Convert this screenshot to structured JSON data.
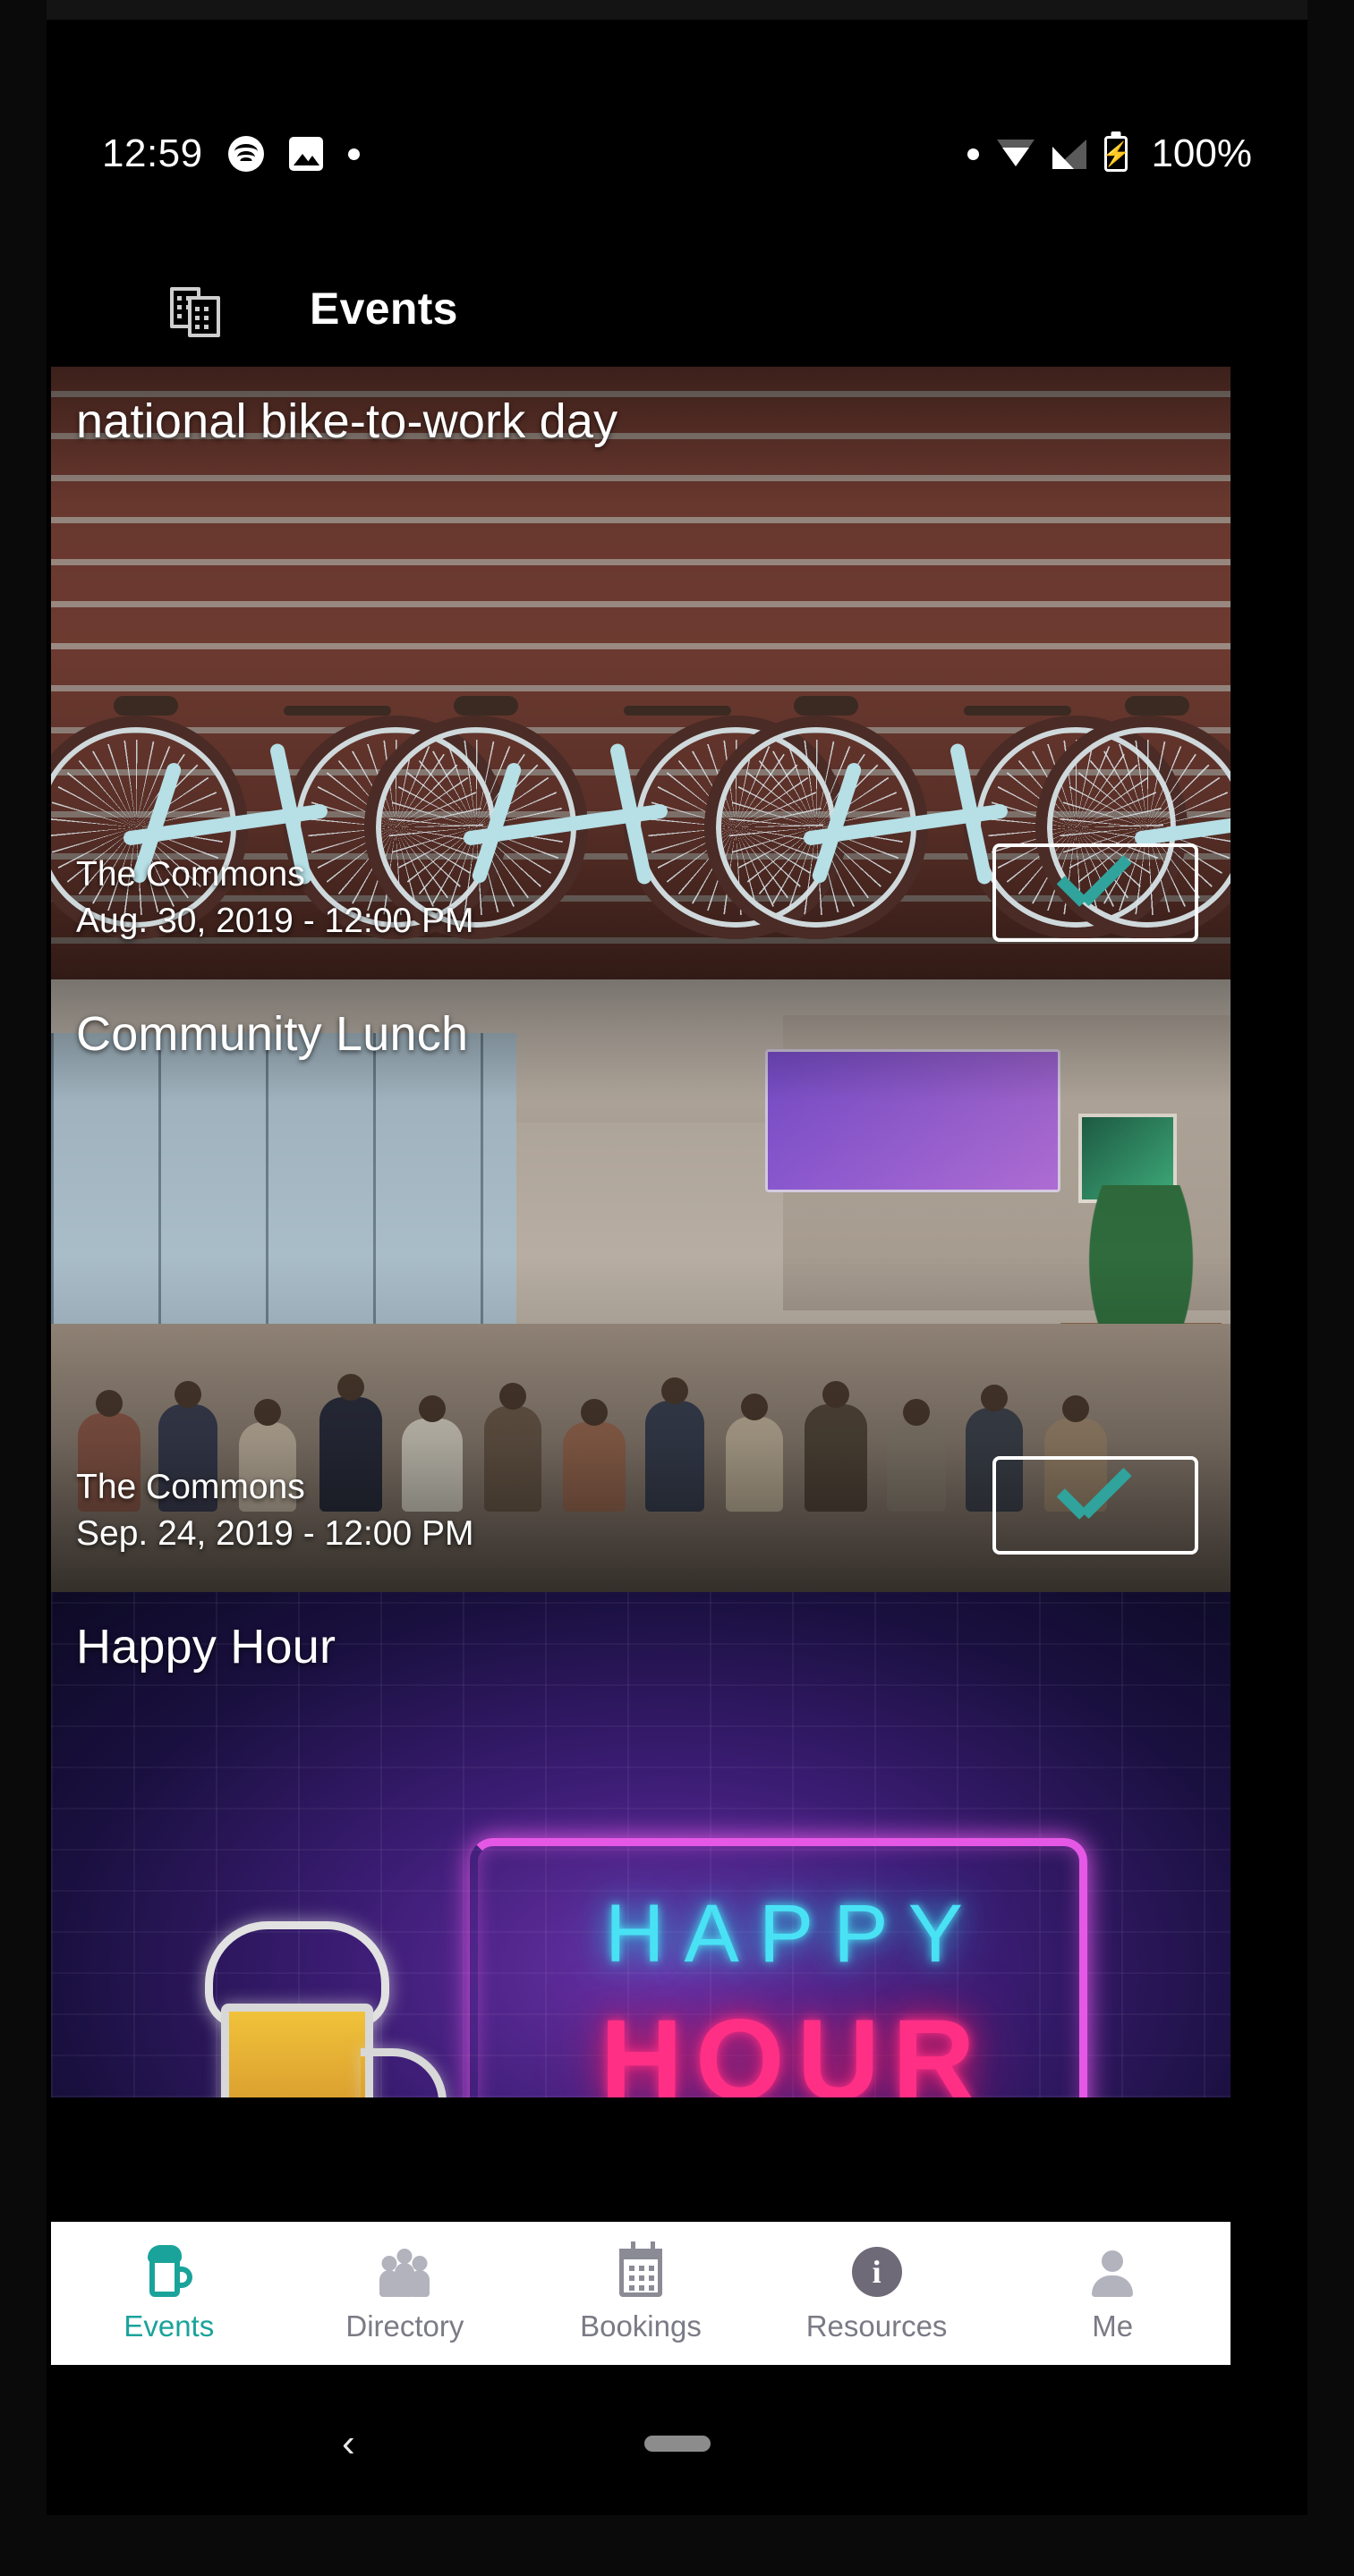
{
  "statusbar": {
    "clock": "12:59",
    "battery_text": "100%",
    "icons_left": [
      "spotify-icon",
      "image-icon",
      "dot-icon"
    ],
    "icons_right": [
      "dot-icon",
      "wifi-icon",
      "cell-signal-icon",
      "battery-charging-icon"
    ]
  },
  "appbar": {
    "icon": "buildings-icon",
    "title": "Events"
  },
  "events": [
    {
      "title": "national bike-to-work day",
      "location": "The Commons",
      "datetime": "Aug. 30, 2019 - 12:00 PM",
      "attend_icon": "check-icon",
      "image": "bicycles-against-brick-wall"
    },
    {
      "title": "Community Lunch",
      "location": "The Commons",
      "datetime": "Sep. 24, 2019 - 12:00 PM",
      "attend_icon": "check-icon",
      "image": "community-room-audience"
    },
    {
      "title": "Happy Hour",
      "image": "happy-hour-neon-sign",
      "neon_line1": "HAPPY",
      "neon_line2": "HOUR"
    }
  ],
  "bottom_nav": {
    "items": [
      {
        "label": "Events",
        "icon": "beer-mug-icon",
        "active": true
      },
      {
        "label": "Directory",
        "icon": "people-icon",
        "active": false
      },
      {
        "label": "Bookings",
        "icon": "calendar-icon",
        "active": false
      },
      {
        "label": "Resources",
        "icon": "info-icon",
        "active": false
      },
      {
        "label": "Me",
        "icon": "person-icon",
        "active": false
      }
    ]
  },
  "system_nav": {
    "back": "‹",
    "home_pill": "home-pill"
  },
  "colors": {
    "accent_teal": "#1aa39b",
    "check_teal": "#2fa39c",
    "nav_inactive": "#7b7b86",
    "neon_cyan": "#49e2f5",
    "neon_pink": "#ff2f86",
    "neon_magenta": "#e558e5",
    "background": "#000000",
    "nav_background": "#ffffff"
  }
}
